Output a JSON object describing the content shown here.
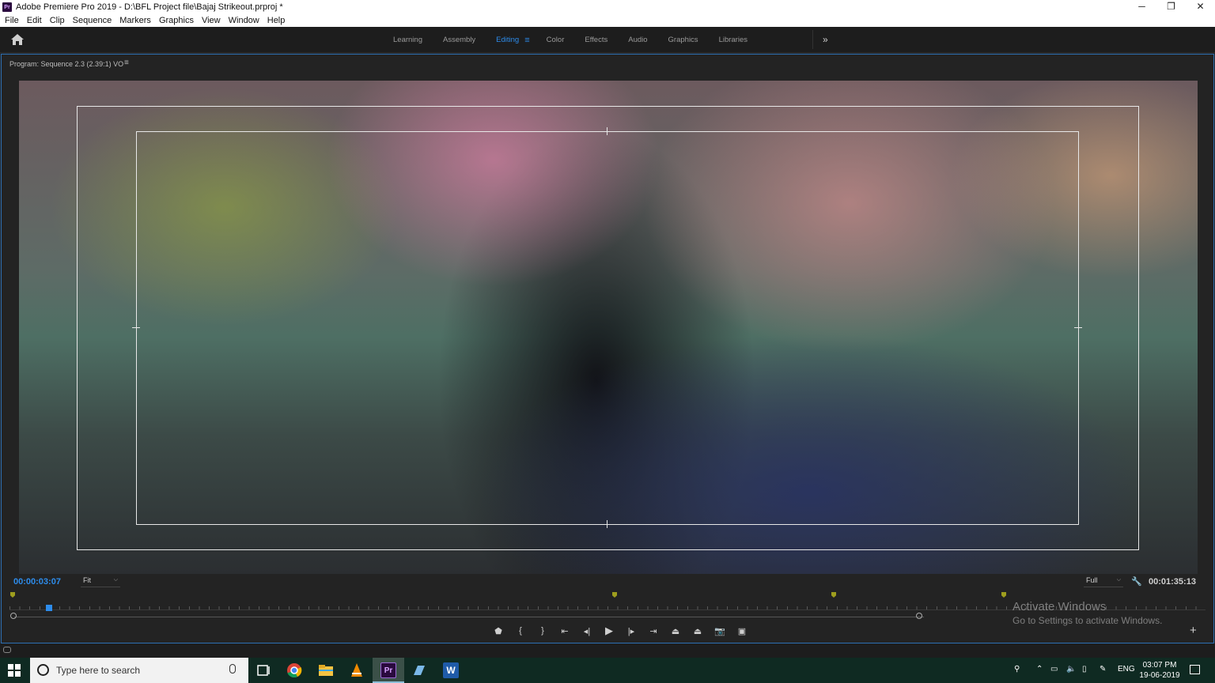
{
  "window": {
    "title": "Adobe Premiere Pro 2019 - D:\\BFL Project file\\Bajaj Strikeout.prproj *",
    "app_icon_label": "Pr",
    "minimize": "─",
    "restore": "❐",
    "close": "✕"
  },
  "menu": [
    "File",
    "Edit",
    "Clip",
    "Sequence",
    "Markers",
    "Graphics",
    "View",
    "Window",
    "Help"
  ],
  "workspaces": {
    "tabs": [
      "Learning",
      "Assembly",
      "Editing",
      "Color",
      "Effects",
      "Audio",
      "Graphics",
      "Libraries"
    ],
    "active": "Editing",
    "more": "»",
    "menu_icon": "≡"
  },
  "monitor": {
    "title": "Program: Sequence 2.3 (2.39:1) VO",
    "menu_icon": "≡",
    "current_timecode": "00:00:03:07",
    "zoom": "Fit",
    "resolution": "Full",
    "duration": "00:01:35:13",
    "dropdown_arrow": "⌵"
  },
  "transport": {
    "buttons": [
      {
        "name": "add-marker-button",
        "icon": "⬟"
      },
      {
        "name": "mark-in-button",
        "icon": "{"
      },
      {
        "name": "mark-out-button",
        "icon": "}"
      },
      {
        "name": "go-to-in-button",
        "icon": "⇤"
      },
      {
        "name": "step-back-button",
        "icon": "◂|"
      },
      {
        "name": "play-button",
        "icon": "▶"
      },
      {
        "name": "step-forward-button",
        "icon": "|▸"
      },
      {
        "name": "go-to-out-button",
        "icon": "⇥"
      },
      {
        "name": "lift-button",
        "icon": "⏏"
      },
      {
        "name": "extract-button",
        "icon": "⏏"
      },
      {
        "name": "export-frame-button",
        "icon": "📷"
      },
      {
        "name": "compare-view-button",
        "icon": "▣"
      }
    ],
    "add_button": "+"
  },
  "watermark": {
    "line1": "Activate Windows",
    "line2": "Go to Settings to activate Windows."
  },
  "taskbar": {
    "search_placeholder": "Type here to search",
    "language": "ENG",
    "time": "03:07 PM",
    "date": "19-06-2019",
    "premiere_label": "Pr",
    "word_label": "W"
  }
}
